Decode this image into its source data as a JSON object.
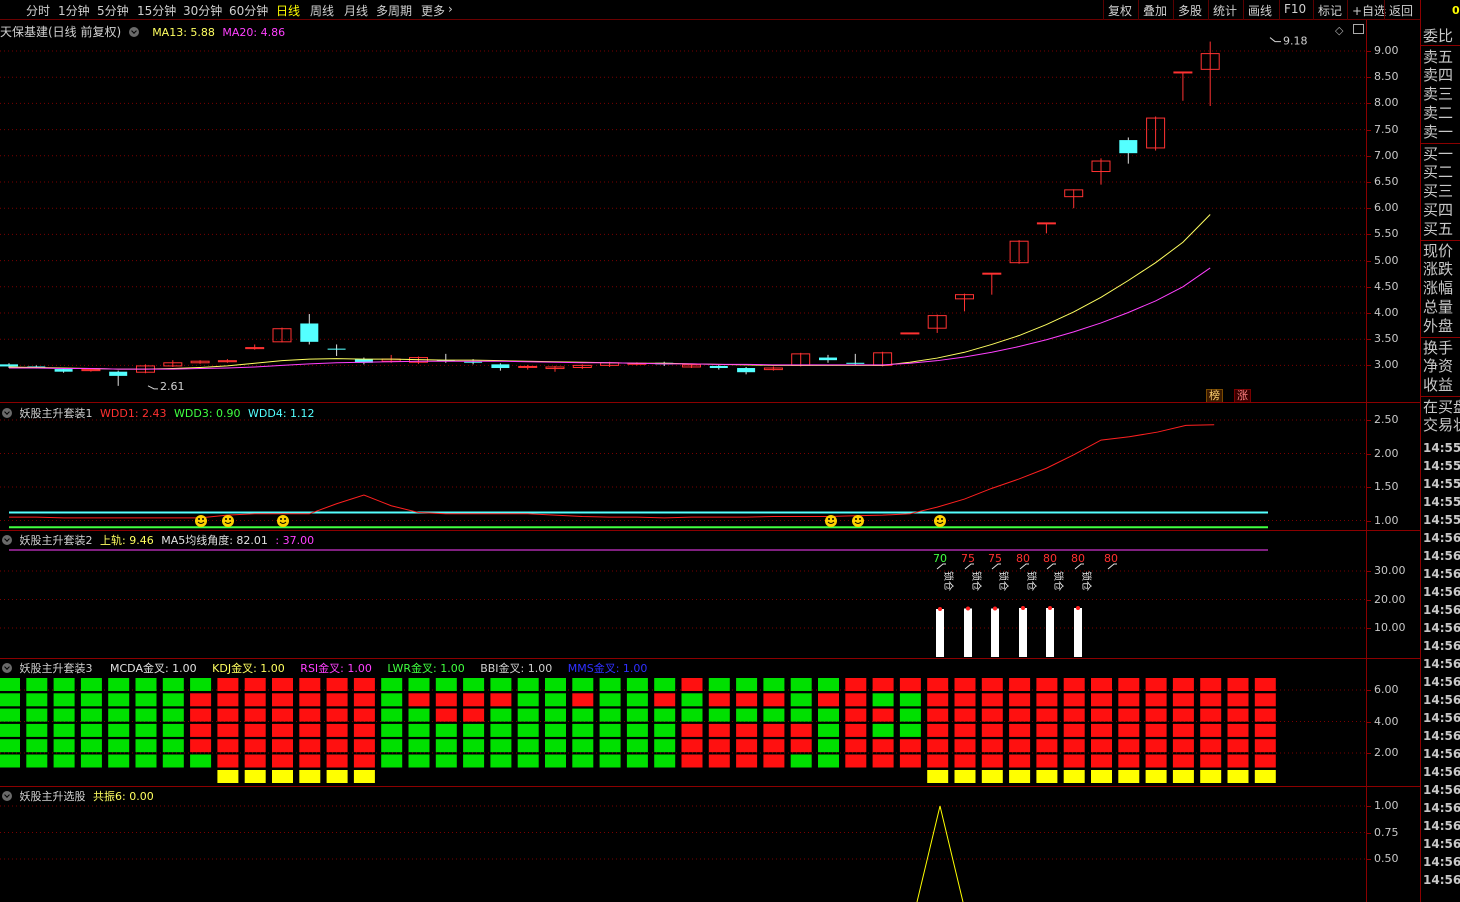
{
  "toolbar": {
    "periods": [
      "分时",
      "1分钟",
      "5分钟",
      "15分钟",
      "30分钟",
      "60分钟",
      "日线",
      "周线",
      "月线",
      "多周期",
      "更多"
    ],
    "active_period": "日线",
    "more_chevron": "chevron-right-icon",
    "actions": [
      "复权",
      "叠加",
      "多股",
      "统计",
      "画线",
      "F10",
      "标记",
      "+自选",
      "返回"
    ]
  },
  "main_panel": {
    "title": "天保基建(日线 前复权)",
    "ma13_label": "MA13: 5.88",
    "ma20_label": "MA20: 4.86",
    "high_label": "9.18",
    "low_label": "2.61",
    "tag_bang": "榜",
    "tag_zhang": "涨",
    "y_ticks": [
      "9.00",
      "8.50",
      "8.00",
      "7.50",
      "7.00",
      "6.50",
      "6.00",
      "5.50",
      "5.00",
      "4.50",
      "4.00",
      "3.50",
      "3.00"
    ],
    "colors": {
      "up": "#ff3232",
      "down": "#54ffff",
      "ma13": "#ffff60",
      "ma20": "#ff40ff"
    }
  },
  "panel1": {
    "title": "妖股主升套装1",
    "wdd1": "WDD1: 2.43",
    "wdd3": "WDD3: 0.90",
    "wdd4": "WDD4: 1.12",
    "y_ticks": [
      "2.50",
      "2.00",
      "1.50",
      "1.00"
    ],
    "smiley_icon": "smiley-icon"
  },
  "panel2": {
    "title": "妖股主升套装2",
    "upper_label": "上轨: 9.46",
    "ma5_angle": "MA5均线角度: 82.01",
    "extra": ": 37.00",
    "y_ticks": [
      "30.00",
      "20.00",
      "10.00"
    ],
    "bar_values": [
      "70",
      "75",
      "75",
      "80",
      "80",
      "80",
      "80"
    ],
    "lock_text": "锁仓"
  },
  "panel3": {
    "title": "妖股主升套装3",
    "mcda": "MCDA金叉: 1.00",
    "kdj": "KDJ金叉: 1.00",
    "rsi": "RSI金叉: 1.00",
    "lwr": "LWR金叉: 1.00",
    "bbi": "BBI金叉: 1.00",
    "mms": "MMS金叉: 1.00",
    "y_ticks": [
      "6.00",
      "4.00",
      "2.00"
    ]
  },
  "panel4": {
    "title": "妖股主升选股",
    "resonance": "共振6: 0.00",
    "y_ticks": [
      "1.00",
      "0.75",
      "0.50"
    ]
  },
  "side": {
    "corner": "0",
    "items": [
      "委比",
      "卖五",
      "卖四",
      "卖三",
      "卖二",
      "卖一",
      "买一",
      "买二",
      "买三",
      "买四",
      "买五",
      "现价",
      "涨跌",
      "涨幅",
      "总量",
      "外盘",
      "换手",
      "净资",
      "收益",
      "在买盘",
      "交易状"
    ],
    "time": "14:55",
    "time2": "14:56"
  },
  "chart_data": [
    {
      "type": "candlestick",
      "title": "天保基建(日线 前复权)",
      "series": [
        {
          "name": "MA13"
        },
        {
          "name": "MA20"
        }
      ],
      "ylim": [
        2.6,
        9.3
      ],
      "high": 9.18,
      "low": 2.61
    },
    {
      "type": "line",
      "title": "妖股主升套装1",
      "ylim": [
        0.9,
        2.6
      ]
    },
    {
      "type": "bar",
      "title": "妖股主升套装2",
      "values": [
        70,
        75,
        75,
        80,
        80,
        80,
        80
      ],
      "ylim": [
        0,
        40
      ]
    },
    {
      "type": "heatmap",
      "title": "妖股主升套装3",
      "ylim": [
        0,
        7
      ]
    },
    {
      "type": "line",
      "title": "妖股主升选股",
      "ylim": [
        0,
        1.1
      ]
    }
  ]
}
